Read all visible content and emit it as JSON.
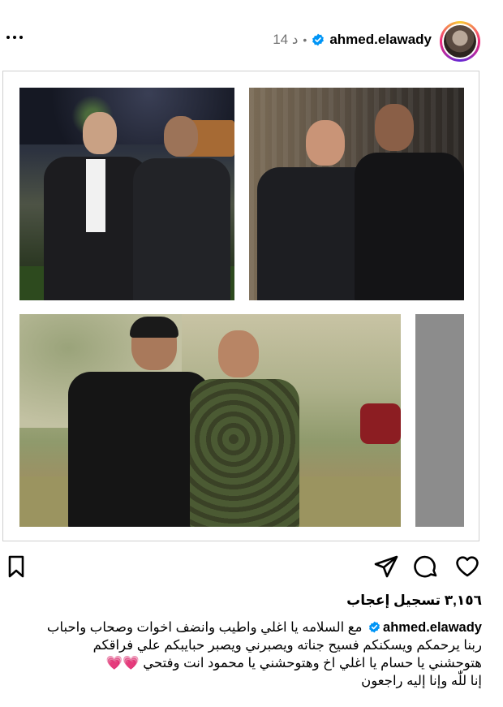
{
  "header": {
    "username": "ahmed.elawady",
    "separator": "•",
    "time_ago": "14 د",
    "more_label": "More options"
  },
  "actions": {
    "save_icon": "bookmark-icon",
    "share_icon": "share-icon",
    "comment_icon": "comment-icon",
    "like_icon": "heart-icon"
  },
  "likes": {
    "text": "٣,١٥٦ تسجيل إعجاب"
  },
  "caption": {
    "username": "ahmed.elawady",
    "line1": "مع السلامه يا اغلي واطيب وانضف اخوات وصحاب واحباب",
    "line2": "ربنا يرحمكم ويسكنكم فسيح جناته ويصبرني ويصبر حبايبكم علي فراقكم",
    "line3": "هتوحشني يا حسام يا اغلي اخ وهتوحشني يا محمود انت وفتحي",
    "hearts": "💗💗",
    "line4": "إنا للّٰه وإنا إليه راجعون"
  },
  "colors": {
    "verified": "#0095f6",
    "text_secondary": "#737373",
    "heart": "#f04866"
  }
}
